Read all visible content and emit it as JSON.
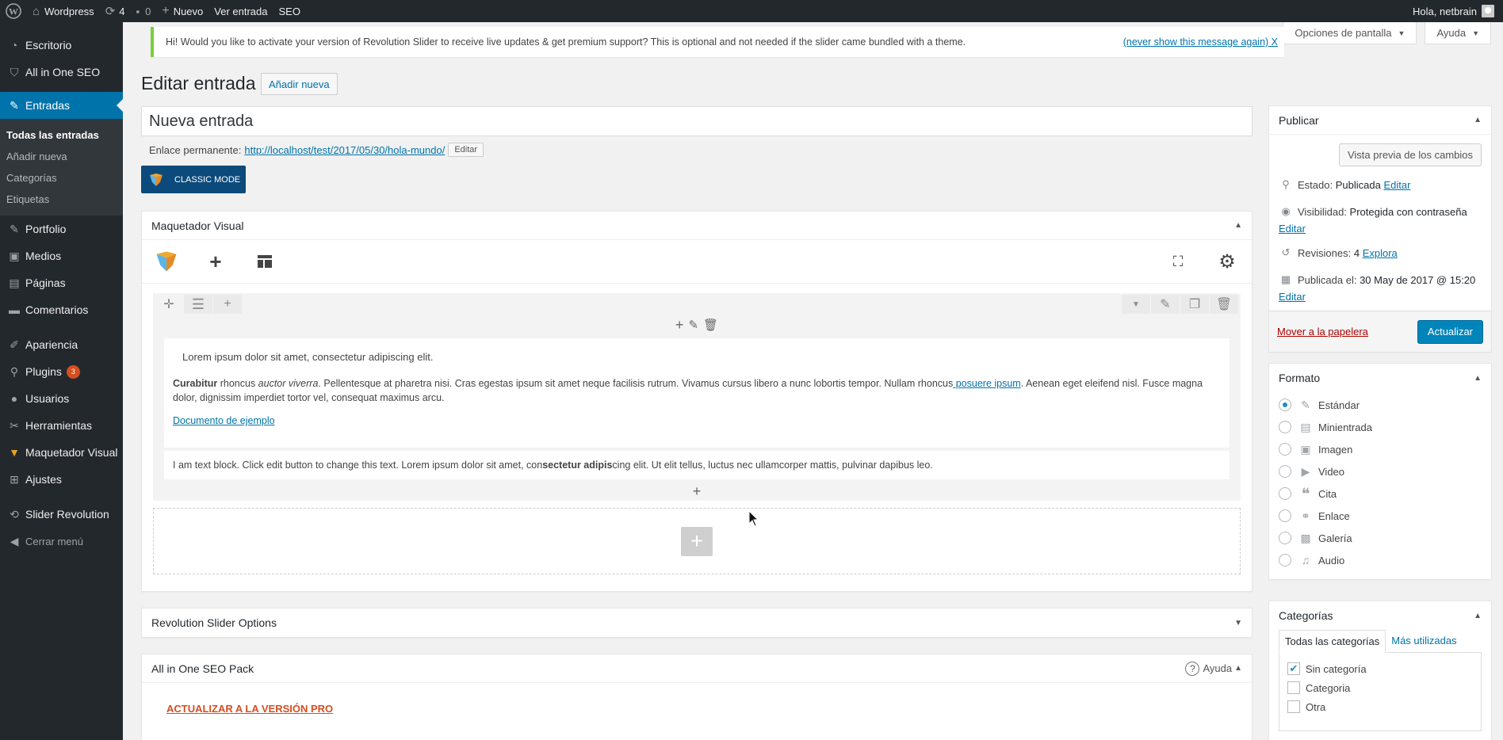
{
  "admin_bar": {
    "site_name": "Wordpress",
    "updates_count": "4",
    "comments_count": "0",
    "new_label": "Nuevo",
    "view_post": "Ver entrada",
    "seo": "SEO",
    "greeting": "Hola, netbrain"
  },
  "sidebar": {
    "items": [
      {
        "label": "Escritorio",
        "icon": "dashboard-icon"
      },
      {
        "label": "All in One SEO",
        "icon": "seo-shield-icon"
      },
      {
        "label": "Entradas",
        "icon": "pushpin-icon"
      },
      {
        "label": "Portfolio",
        "icon": "pushpin-icon"
      },
      {
        "label": "Medios",
        "icon": "media-icon"
      },
      {
        "label": "Páginas",
        "icon": "page-icon"
      },
      {
        "label": "Comentarios",
        "icon": "comment-icon"
      },
      {
        "label": "Apariencia",
        "icon": "brush-icon"
      },
      {
        "label": "Plugins",
        "icon": "plugin-icon",
        "badge": "3"
      },
      {
        "label": "Usuarios",
        "icon": "user-icon"
      },
      {
        "label": "Herramientas",
        "icon": "wrench-icon"
      },
      {
        "label": "Maquetador Visual",
        "icon": "vc-logo-icon"
      },
      {
        "label": "Ajustes",
        "icon": "settings-icon"
      },
      {
        "label": "Slider Revolution",
        "icon": "refresh-icon"
      },
      {
        "label": "Cerrar menú",
        "icon": "collapse-icon"
      }
    ],
    "submenu": [
      "Todas las entradas",
      "Añadir nueva",
      "Categorías",
      "Etiquetas"
    ]
  },
  "screen_options": "Opciones de pantalla",
  "help": "Ayuda",
  "notice": {
    "text": "Hi! Would you like to activate your version of Revolution Slider to receive live updates & get premium support? This is optional and not needed if the slider came bundled with a theme.",
    "dismiss": "(never show this message again)  X"
  },
  "page": {
    "title": "Editar entrada",
    "add_new": "Añadir nueva",
    "post_title": "Nueva entrada",
    "permalink_label": "Enlace permanente:",
    "permalink_url": "http://localhost/test/2017/05/30/hola-mundo/",
    "edit_btn": "Editar",
    "classic_mode": "CLASSIC MODE"
  },
  "visual_composer": {
    "title": "Maquetador Visual",
    "block1": {
      "line1": "Lorem ipsum dolor sit amet, consectetur adipiscing elit.",
      "p_bold": "Curabitur",
      "p_a": " rhoncus ",
      "p_italic": "auctor viverra",
      "p_b": ". Pellentesque at pharetra nisi. Cras egestas ipsum sit amet neque facilisis rutrum. Vivamus cursus libero a nunc lobortis tempor. Nullam rhoncus",
      "p_link": " posuere ipsum",
      "p_c": ". Aenean eget eleifend nisl. Fusce magna dolor, dignissim imperdiet tortor vel, consequat maximus arcu.",
      "doc_link": "Documento de ejemplo"
    },
    "block2": {
      "a": "I am text block. Click edit button to change this text. Lorem ipsum dolor sit amet, con",
      "bold": "sectetur adipis",
      "b": "cing elit. Ut elit tellus, luctus nec ullamcorper mattis, pulvinar dapibus leo."
    }
  },
  "rev_slider_box": "Revolution Slider Options",
  "aioseo_box": {
    "title": "All in One SEO Pack",
    "help": "Ayuda",
    "upgrade": "ACTUALIZAR A LA VERSIÓN PRO"
  },
  "publish": {
    "title": "Publicar",
    "preview": "Vista previa de los cambios",
    "status_label": "Estado:",
    "status_value": "Publicada",
    "edit": "Editar",
    "visibility_label": "Visibilidad:",
    "visibility_value": "Protegida con contraseña",
    "revisions_label": "Revisiones:",
    "revisions_value": "4",
    "revisions_link": "Explora",
    "published_label": "Publicada el:",
    "published_value": "30 May de 2017 @ 15:20",
    "trash": "Mover a la papelera",
    "update": "Actualizar"
  },
  "format": {
    "title": "Formato",
    "options": [
      {
        "label": "Estándar",
        "icon": "pushpin-icon",
        "selected": true
      },
      {
        "label": "Minientrada",
        "icon": "aside-icon",
        "selected": false
      },
      {
        "label": "Imagen",
        "icon": "image-icon",
        "selected": false
      },
      {
        "label": "Video",
        "icon": "video-icon",
        "selected": false
      },
      {
        "label": "Cita",
        "icon": "quote-icon",
        "selected": false
      },
      {
        "label": "Enlace",
        "icon": "link-icon",
        "selected": false
      },
      {
        "label": "Galería",
        "icon": "gallery-icon",
        "selected": false
      },
      {
        "label": "Audio",
        "icon": "audio-icon",
        "selected": false
      }
    ]
  },
  "categories": {
    "title": "Categorías",
    "tab_all": "Todas las categorías",
    "tab_popular": "Más utilizadas",
    "items": [
      {
        "label": "Sin categoría",
        "checked": true
      },
      {
        "label": "Categoria",
        "checked": false
      },
      {
        "label": "Otra",
        "checked": false
      }
    ]
  }
}
